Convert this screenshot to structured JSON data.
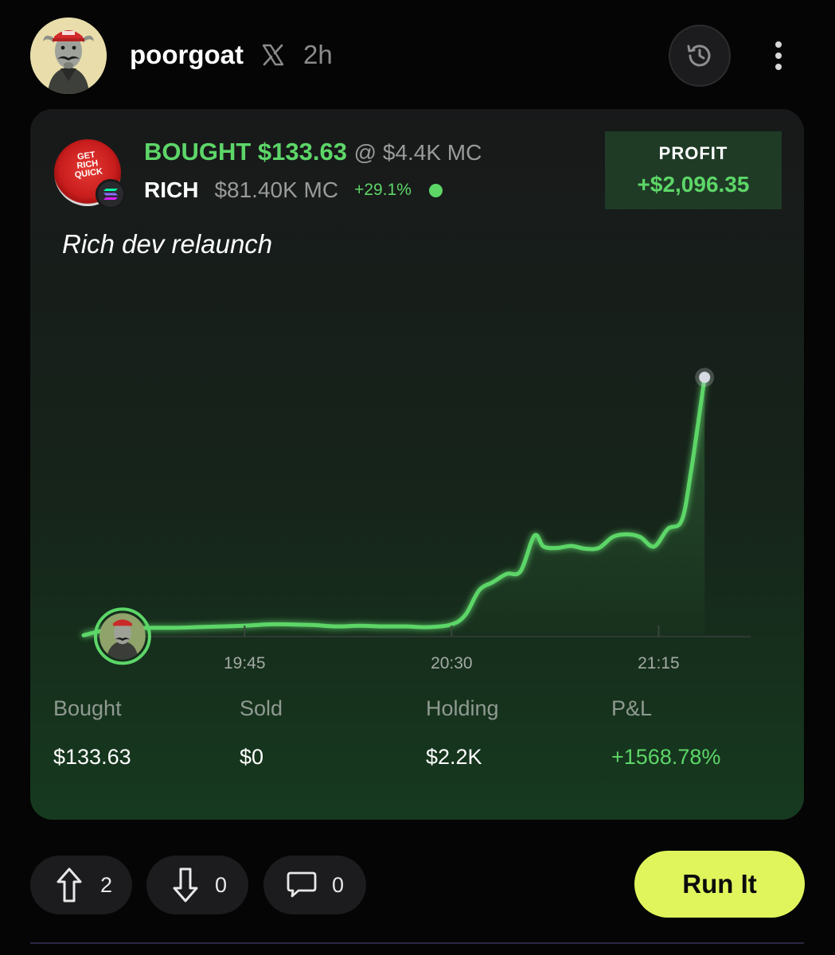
{
  "post": {
    "username": "poorgoat",
    "platform_icon": "x-logo-icon",
    "time_ago": "2h"
  },
  "header_actions": {
    "history_icon": "history-icon",
    "more_icon": "more-vertical-icon"
  },
  "trade": {
    "bought_label": "BOUGHT $133.63",
    "entry_mc": "@ $4.4K MC",
    "token_logo_text": "GET RICH QUICK",
    "ticker": "RICH",
    "current_mc": "$81.40K MC",
    "change": "+29.1%",
    "chain_icon": "solana-icon",
    "profit_label": "PROFIT",
    "profit_value": "+$2,096.35",
    "note": "Rich dev relaunch"
  },
  "chart_data": {
    "type": "area",
    "x_ticks": [
      "19:45",
      "20:30",
      "21:15"
    ],
    "x": [
      "19:10",
      "19:15",
      "19:20",
      "19:25",
      "19:30",
      "19:35",
      "19:40",
      "19:45",
      "19:50",
      "19:55",
      "20:00",
      "20:05",
      "20:10",
      "20:15",
      "20:20",
      "20:25",
      "20:30",
      "20:33",
      "20:36",
      "20:39",
      "20:42",
      "20:45",
      "20:48",
      "20:50",
      "20:53",
      "20:56",
      "20:59",
      "21:02",
      "21:05",
      "21:08",
      "21:11",
      "21:14",
      "21:17",
      "21:20",
      "21:22",
      "21:25"
    ],
    "values": [
      0.2,
      1.0,
      1.2,
      1.3,
      1.3,
      1.4,
      1.5,
      1.6,
      1.8,
      1.8,
      1.7,
      1.5,
      1.6,
      1.5,
      1.5,
      1.4,
      1.8,
      3.2,
      6.8,
      8.0,
      9.2,
      9.6,
      14.8,
      13.2,
      13.0,
      13.3,
      12.9,
      13.0,
      14.6,
      15.0,
      14.6,
      13.2,
      15.8,
      17.0,
      24.0,
      38.0
    ],
    "ylim": [
      0,
      40
    ],
    "line_color": "#5dd668",
    "entry_marker": "poorgoat-avatar",
    "grid": false
  },
  "stats": [
    {
      "label": "Bought",
      "value": "$133.63",
      "positive": false
    },
    {
      "label": "Sold",
      "value": "$0",
      "positive": false
    },
    {
      "label": "Holding",
      "value": "$2.2K",
      "positive": false
    },
    {
      "label": "P&L",
      "value": "+1568.78%",
      "positive": true
    }
  ],
  "actions": {
    "upvote_icon": "arrow-up-icon",
    "upvotes": "2",
    "downvote_icon": "arrow-down-icon",
    "downvotes": "0",
    "comment_icon": "comment-icon",
    "comments": "0",
    "run_label": "Run It"
  },
  "colors": {
    "accent_green": "#5dd668",
    "run_button": "#e0f55c",
    "background": "#050505"
  }
}
